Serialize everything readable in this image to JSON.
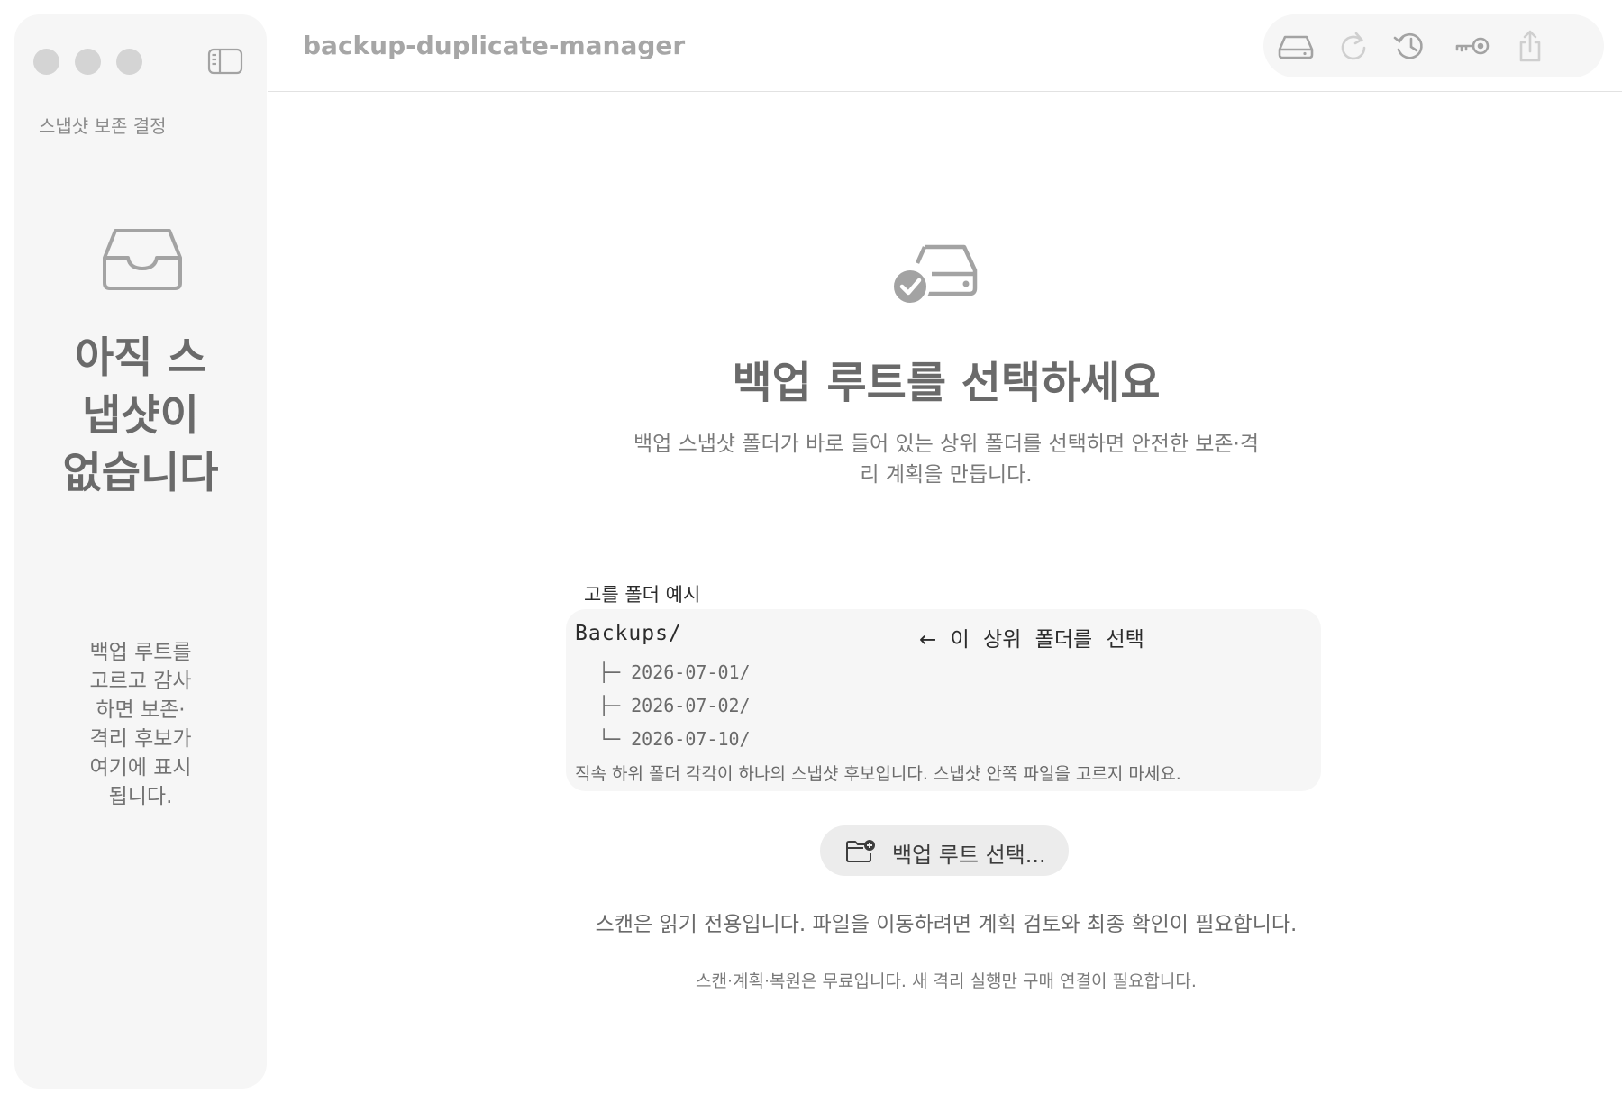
{
  "window": {
    "title": "backup-duplicate-manager"
  },
  "sidebar": {
    "section_label": "스냅샷 보존 결정",
    "empty_title": "아직 스냅샷이 없습니다",
    "empty_hint": "백업 루트를 고르고 감사하면 보존·격리 후보가 여기에 표시됩니다."
  },
  "toolbar": {
    "icons": [
      "drive-icon",
      "refresh-icon",
      "history-icon",
      "key-icon",
      "share-icon"
    ]
  },
  "main": {
    "title": "백업 루트를 선택하세요",
    "description": "백업 스냅샷 폴더가 바로 들어 있는 상위 폴더를 선택하면 안전한 보존·격리 계획을 만듭니다.",
    "example": {
      "label": "고를 폴더 예시",
      "root": "Backups/",
      "root_hint": "← 이 상위 폴더를 선택",
      "children": [
        "├─ 2026-07-01/",
        "├─ 2026-07-02/",
        "└─ 2026-07-10/"
      ],
      "note": "직속 하위 폴더 각각이 하나의 스냅샷 후보입니다. 스냅샷 안쪽 파일을 고르지 마세요."
    },
    "choose_button": "백업 루트 선택...",
    "readonly_note": "스캔은 읽기 전용입니다. 파일을 이동하려면 계획 검토와 최종 확인이 필요합니다.",
    "pricing_note": "스캔·계획·복원은 무료입니다. 새 격리 실행만 구매 연결이 필요합니다."
  },
  "colors": {
    "icon_gray": "#a3a3a3",
    "sidebar_bg": "#f6f6f6",
    "button_bg": "#ececec"
  }
}
